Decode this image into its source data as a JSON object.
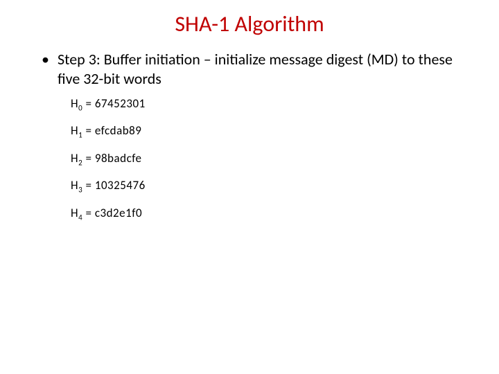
{
  "title": "SHA-1 Algorithm",
  "bullet": {
    "marker": "•",
    "text": "Step 3: Buffer initiation – initialize message digest (MD) to these five 32-bit words"
  },
  "values": [
    {
      "label": "H",
      "sub": "0",
      "eq": " = 67452301"
    },
    {
      "label": "H",
      "sub": "1",
      "eq": " = efcdab89"
    },
    {
      "label": "H",
      "sub": "2",
      "eq": " = 98badcfe"
    },
    {
      "label": "H",
      "sub": "3",
      "eq": " = 10325476"
    },
    {
      "label": "H",
      "sub": "4",
      "eq": " = c3d2e1f0"
    }
  ]
}
